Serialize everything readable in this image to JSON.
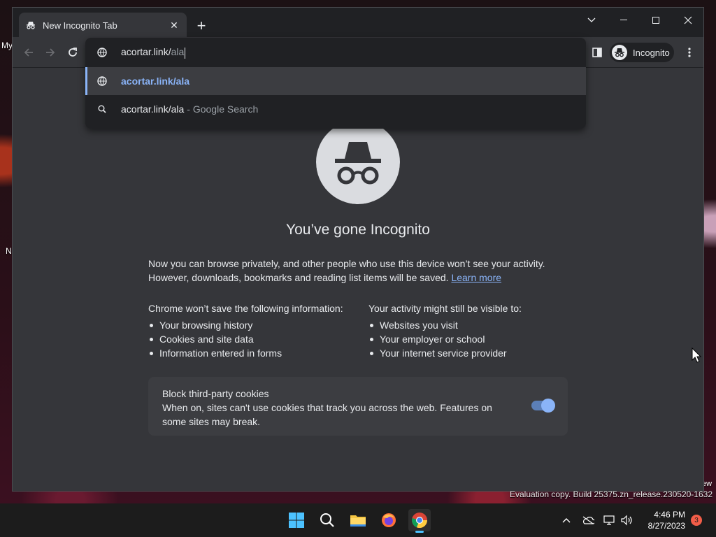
{
  "desktop": {
    "left_label_top": "My",
    "left_label_bottom": "N",
    "right_label": "ew"
  },
  "browser": {
    "tab": {
      "title": "New Incognito Tab"
    },
    "window_controls": [
      "chevron-down",
      "minimize",
      "maximize",
      "close"
    ],
    "profile_label": "Incognito",
    "omnibox": {
      "typed": "acortar.link/",
      "autocomplete": "ala",
      "suggestions": [
        {
          "icon": "globe-icon",
          "text": "acortar.link/ala",
          "desc": ""
        },
        {
          "icon": "search-icon",
          "text": "acortar.link/ala",
          "desc": "- Google Search"
        }
      ]
    }
  },
  "page": {
    "title": "You’ve gone Incognito",
    "intro_line1": "Now you can browse privately, and other people who use this device won’t see your activity.",
    "intro_line2": "However, downloads, bookmarks and reading list items will be saved.",
    "learn_more": "Learn more",
    "left_col": {
      "heading": "Chrome won’t save the following information:",
      "items": [
        "Your browsing history",
        "Cookies and site data",
        "Information entered in forms"
      ]
    },
    "right_col": {
      "heading": "Your activity might still be visible to:",
      "items": [
        "Websites you visit",
        "Your employer or school",
        "Your internet service provider"
      ]
    },
    "cookies": {
      "title": "Block third-party cookies",
      "desc": "When on, sites can't use cookies that track you across the web. Features on some sites may break.",
      "enabled": true
    }
  },
  "watermark": "Evaluation copy. Build 25375.zn_release.230520-1632",
  "taskbar": {
    "time": "4:46 PM",
    "date": "8/27/2023",
    "notification_count": "3"
  },
  "colors": {
    "accent": "#8ab4f8",
    "window_bg": "#35363a",
    "tabstrip_bg": "#202124"
  }
}
